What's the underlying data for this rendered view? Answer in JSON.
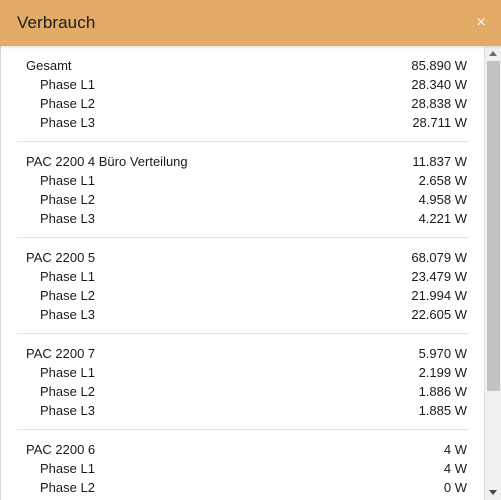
{
  "dialog": {
    "title": "Verbrauch",
    "close_label": "×",
    "accent_color": "#e3ab68",
    "text_color": "#1a1a1a",
    "divider_color": "#e2e2e2"
  },
  "icons": {
    "close": "close-icon",
    "scroll_up": "scroll-up-arrow-icon",
    "scroll_down": "scroll-down-arrow-icon"
  },
  "groups": [
    {
      "name": "Gesamt",
      "value": "85.890 W",
      "phases": [
        {
          "label": "Phase L1",
          "value": "28.340 W"
        },
        {
          "label": "Phase L2",
          "value": "28.838 W"
        },
        {
          "label": "Phase L3",
          "value": "28.711 W"
        }
      ]
    },
    {
      "name": "PAC 2200 4 Büro Verteilung",
      "value": "11.837 W",
      "phases": [
        {
          "label": "Phase L1",
          "value": "2.658 W"
        },
        {
          "label": "Phase L2",
          "value": "4.958 W"
        },
        {
          "label": "Phase L3",
          "value": "4.221 W"
        }
      ]
    },
    {
      "name": "PAC 2200 5",
      "value": "68.079 W",
      "phases": [
        {
          "label": "Phase L1",
          "value": "23.479 W"
        },
        {
          "label": "Phase L2",
          "value": "21.994 W"
        },
        {
          "label": "Phase L3",
          "value": "22.605 W"
        }
      ]
    },
    {
      "name": "PAC 2200 7",
      "value": "5.970 W",
      "phases": [
        {
          "label": "Phase L1",
          "value": "2.199 W"
        },
        {
          "label": "Phase L2",
          "value": "1.886 W"
        },
        {
          "label": "Phase L3",
          "value": "1.885 W"
        }
      ]
    },
    {
      "name": "PAC 2200 6",
      "value": "4 W",
      "phases": [
        {
          "label": "Phase L1",
          "value": "4 W"
        },
        {
          "label": "Phase L2",
          "value": "0 W"
        }
      ]
    }
  ]
}
